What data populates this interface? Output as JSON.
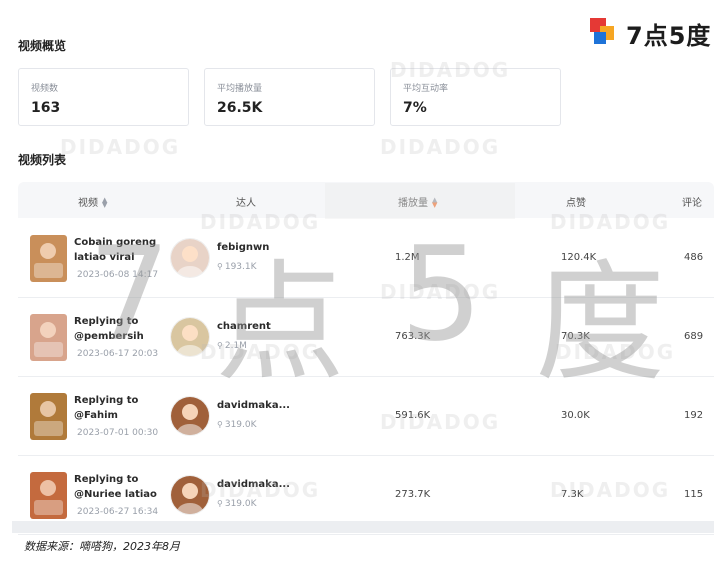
{
  "logo": {
    "text": "7点5度"
  },
  "overview": {
    "title": "视频概览",
    "stats": [
      {
        "label": "视频数",
        "value": "163"
      },
      {
        "label": "平均播放量",
        "value": "26.5K"
      },
      {
        "label": "平均互动率",
        "value": "7%"
      }
    ]
  },
  "list": {
    "title": "视频列表",
    "columns": {
      "video": "视频",
      "creator": "达人",
      "plays": "播放量",
      "likes": "点赞",
      "comments": "评论"
    },
    "rows": [
      {
        "title": "Cobain goreng latiao viral",
        "date": "2023-06-08 14:17",
        "creator": "febignwn",
        "fans": "193.1K",
        "plays": "1.2M",
        "likes": "120.4K",
        "comments": "486",
        "thumb_color": "#c98f5a",
        "avatar_color": "#e8d3c7"
      },
      {
        "title": "Replying to @pembersih dos...",
        "date": "2023-06-17 20:03",
        "creator": "chamrent",
        "fans": "2.1M",
        "plays": "763.3K",
        "likes": "70.3K",
        "comments": "689",
        "thumb_color": "#d8a48c",
        "avatar_color": "#d9c6a0"
      },
      {
        "title": "Replying to @Fahim Mantiqi...",
        "date": "2023-07-01 00:30",
        "creator": "davidmaka...",
        "fans": "319.0K",
        "plays": "591.6K",
        "likes": "30.0K",
        "comments": "192",
        "thumb_color": "#b07a3a",
        "avatar_color": "#a0603a"
      },
      {
        "title": "Replying to @Nuriee latiao ...",
        "date": "2023-06-27 16:34",
        "creator": "davidmaka...",
        "fans": "319.0K",
        "plays": "273.7K",
        "likes": "7.3K",
        "comments": "115",
        "thumb_color": "#c46a3e",
        "avatar_color": "#a0603a"
      }
    ]
  },
  "watermark": {
    "text": "DIDADOG",
    "big_7": "7",
    "big_dian": "点",
    "big_5": "5",
    "big_du": "度"
  },
  "source": "数据来源：嘀嗒狗，2023年8月"
}
